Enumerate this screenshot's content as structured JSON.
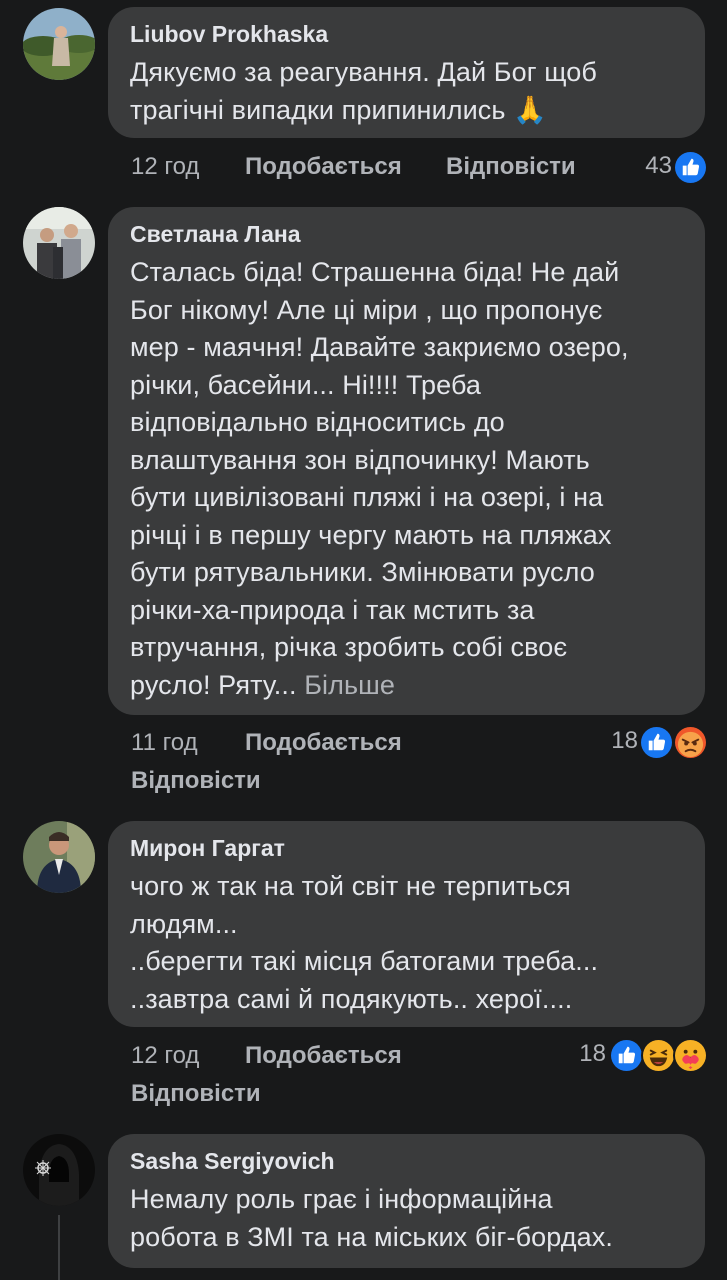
{
  "comments": [
    {
      "author": "Liubov Prokhaska",
      "text": "Дякуємо за реагування. Дай Бог щоб\nтрагічні випадки припинились",
      "emoji": "🙏",
      "time": "12 год",
      "like_label": "Подобається",
      "reply_label": "Відповісти",
      "reaction_count": "43",
      "reactions": [
        "like"
      ]
    },
    {
      "author": "Светлана Лана",
      "text": "Сталась біда! Страшенна біда! Не дай\nБог нікому! Але ці міри , що пропонує\nмер - маячня! Давайте закриємо озеро,\nрічки, басейни... Ні!!!! Треба\nвідповідально відноситись до\nвлаштування зон відпочинку! Мають\nбути цивілізовані пляжі і на озері, і на\nрічці і в першу чергу мають на пляжах\nбути рятувальники. Змінювати русло\nрічки-ха-природа і так мстить за\nвтручання, річка зробить собі своє\nрусло! Ряту... ",
      "more_label": "Більше",
      "time": "11 год",
      "like_label": "Подобається",
      "reply_label": "Відповісти",
      "reaction_count": "18",
      "reactions": [
        "like",
        "angry"
      ]
    },
    {
      "author": "Мирон Гаргат",
      "text": "чого ж так на той світ не терпиться\nлюдям...\n..берегти такі  місця батогами треба...\n..завтра самі  й  подякують.. херої....",
      "time": "12 год",
      "like_label": "Подобається",
      "reply_label": "Відповісти",
      "reaction_count": "18",
      "reactions": [
        "like",
        "haha",
        "care"
      ]
    },
    {
      "author": "Sasha Sergiyovich",
      "text": "Немалу роль грає і інформаційна\nробота в ЗМІ та на міських біг-бордах."
    }
  ],
  "colors": {
    "background": "#18191a",
    "bubble": "#3a3b3c",
    "text": "#e4e6eb",
    "secondary": "#b0b3b8",
    "like_blue": "#1877f2",
    "angry_orange": "#f0572a",
    "haha_yellow": "#f7b125"
  }
}
